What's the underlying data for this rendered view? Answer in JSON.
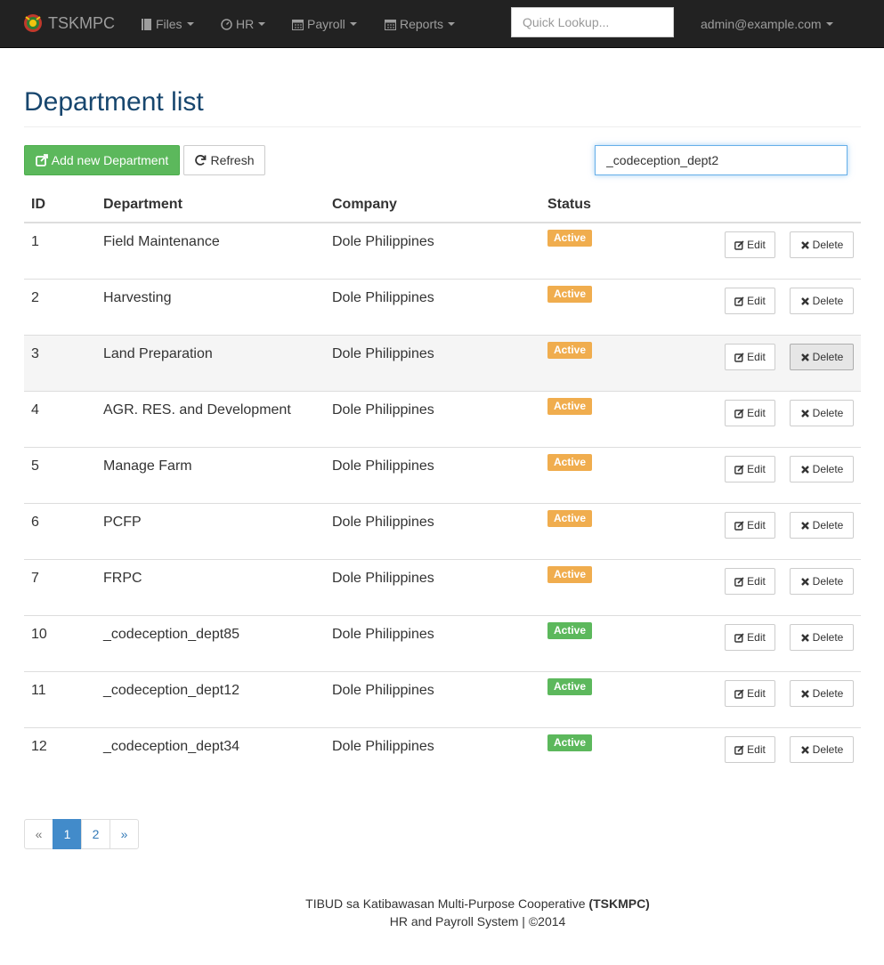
{
  "navbar": {
    "brand": "TSKMPC",
    "menus": [
      {
        "label": "Files",
        "icon": "book-icon"
      },
      {
        "label": "HR",
        "icon": "dashboard-icon"
      },
      {
        "label": "Payroll",
        "icon": "calendar-icon"
      },
      {
        "label": "Reports",
        "icon": "calendar-icon"
      }
    ],
    "lookup_placeholder": "Quick Lookup...",
    "user": "admin@example.com"
  },
  "page": {
    "title": "Department list",
    "add_button": "Add new Department",
    "refresh_button": "Refresh",
    "search_value": "_codeception_dept2"
  },
  "table": {
    "headers": {
      "id": "ID",
      "department": "Department",
      "company": "Company",
      "status": "Status"
    },
    "edit_label": "Edit",
    "delete_label": "Delete",
    "rows": [
      {
        "id": "1",
        "department": "Field Maintenance",
        "company": "Dole Philippines",
        "status": "Active",
        "status_color": "#f0ad4e"
      },
      {
        "id": "2",
        "department": "Harvesting",
        "company": "Dole Philippines",
        "status": "Active",
        "status_color": "#f0ad4e"
      },
      {
        "id": "3",
        "department": "Land Preparation",
        "company": "Dole Philippines",
        "status": "Active",
        "status_color": "#f0ad4e"
      },
      {
        "id": "4",
        "department": "AGR. RES. and Development",
        "company": "Dole Philippines",
        "status": "Active",
        "status_color": "#f0ad4e"
      },
      {
        "id": "5",
        "department": "Manage Farm",
        "company": "Dole Philippines",
        "status": "Active",
        "status_color": "#f0ad4e"
      },
      {
        "id": "6",
        "department": "PCFP",
        "company": "Dole Philippines",
        "status": "Active",
        "status_color": "#f0ad4e"
      },
      {
        "id": "7",
        "department": "FRPC",
        "company": "Dole Philippines",
        "status": "Active",
        "status_color": "#f0ad4e"
      },
      {
        "id": "10",
        "department": "_codeception_dept85",
        "company": "Dole Philippines",
        "status": "Active",
        "status_color": "#5cb85c"
      },
      {
        "id": "11",
        "department": "_codeception_dept12",
        "company": "Dole Philippines",
        "status": "Active",
        "status_color": "#5cb85c"
      },
      {
        "id": "12",
        "department": "_codeception_dept34",
        "company": "Dole Philippines",
        "status": "Active",
        "status_color": "#5cb85c"
      }
    ]
  },
  "pagination": {
    "prev": "«",
    "pages": [
      "1",
      "2"
    ],
    "current": "1",
    "next": "»"
  },
  "footer": {
    "line1_prefix": "TIBUD sa Katibawasan Multi-Purpose Cooperative ",
    "line1_strong": "(TSKMPC)",
    "line2": "HR and Payroll System | ©2014"
  },
  "colors": {
    "navbar_bg": "#222222",
    "title": "#17466e",
    "primary": "#428bca",
    "success": "#5cb85c",
    "warning": "#f0ad4e"
  }
}
